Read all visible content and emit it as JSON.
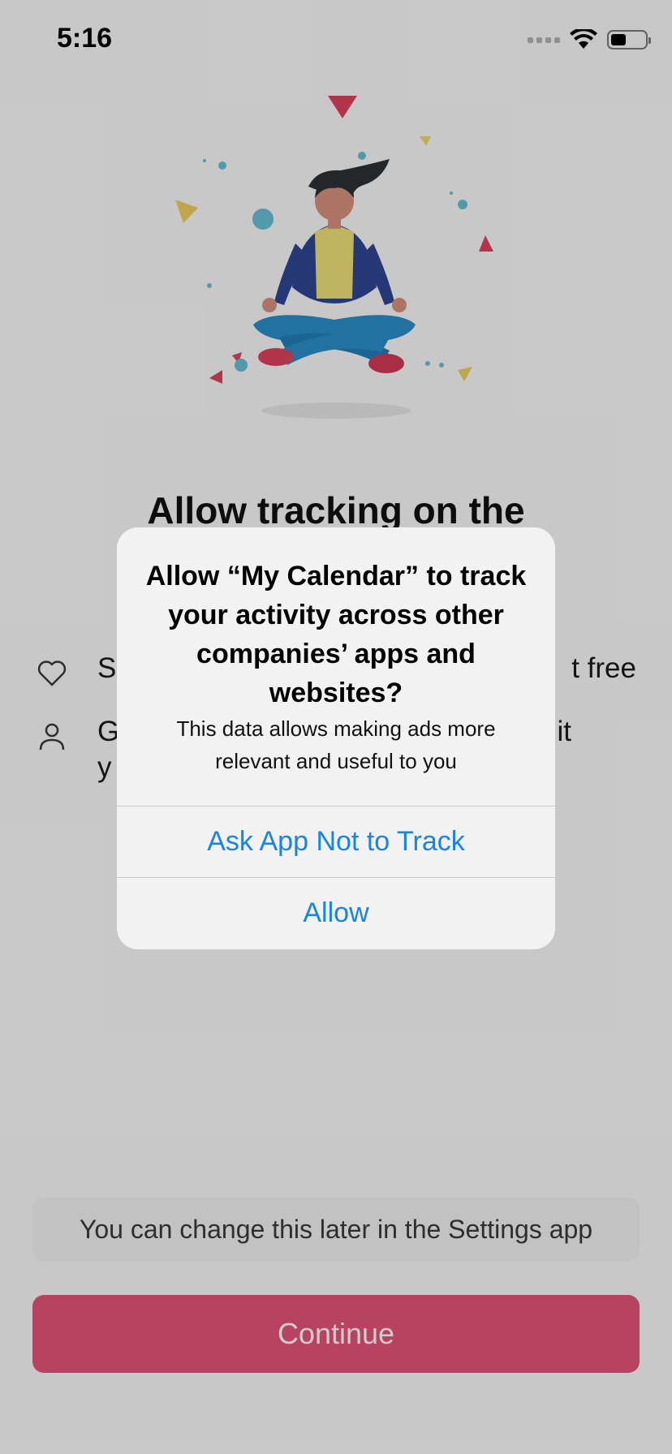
{
  "status_bar": {
    "time": "5:16"
  },
  "onboarding": {
    "title": "Allow tracking on the",
    "features": [
      {
        "icon": "heart-icon",
        "text_left": "S",
        "text_right": "t free"
      },
      {
        "icon": "person-icon",
        "text_left": "G",
        "text_right": "it",
        "text_line2": "y"
      }
    ],
    "hint": "You can change this later in the Settings app",
    "continue_label": "Continue"
  },
  "alert": {
    "title": "Allow “My Calendar” to track your activity across other companies’ apps and websites?",
    "message": "This data allows making ads more relevant and useful to you",
    "deny_label": "Ask App Not to Track",
    "allow_label": "Allow"
  },
  "colors": {
    "accent_pink": "#e55478",
    "link_blue": "#1884e6",
    "dim_overlay": "rgba(0,0,0,0.2)"
  }
}
